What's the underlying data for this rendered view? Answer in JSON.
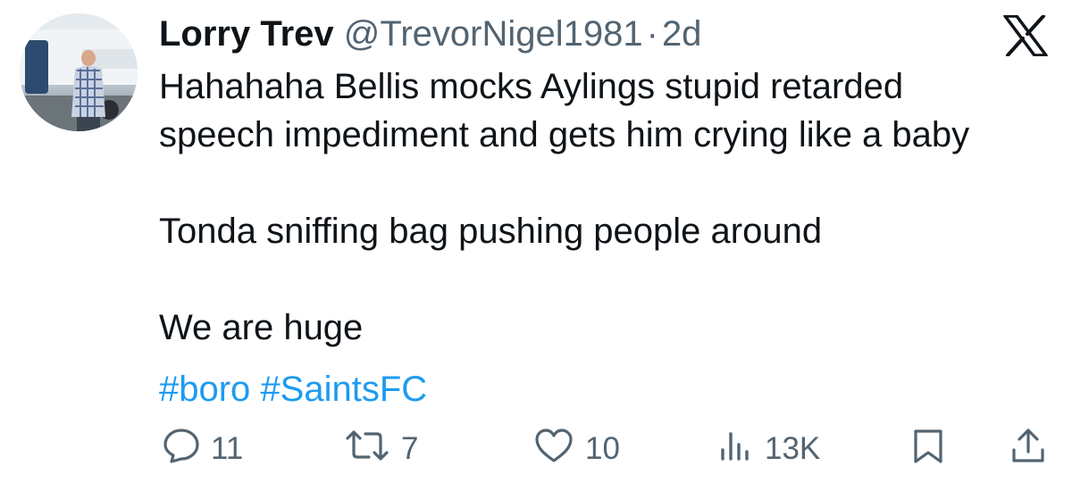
{
  "tweet": {
    "author_name": "Lorry Trev",
    "author_handle": "@TrevorNigel1981",
    "separator": "·",
    "time": "2d",
    "text_lines": [
      "Hahahaha Bellis mocks Aylings stupid retarded",
      "speech impediment and gets him crying like a baby",
      "",
      "Tonda sniffing bag pushing people around",
      "",
      "We are huge"
    ],
    "hashtags": [
      "#boro",
      "#SaintsFC"
    ]
  },
  "icons": {
    "brand": "x-logo-icon",
    "reply": "reply-icon",
    "retweet": "retweet-icon",
    "like": "heart-icon",
    "views": "views-chart-icon",
    "bookmark": "bookmark-icon",
    "share": "share-icon"
  },
  "actions": {
    "reply_count": "11",
    "retweet_count": "7",
    "like_count": "10",
    "view_count": "13K"
  },
  "colors": {
    "text": "#0f1419",
    "secondary": "#536471",
    "link": "#1d9bf0",
    "background": "#ffffff"
  }
}
